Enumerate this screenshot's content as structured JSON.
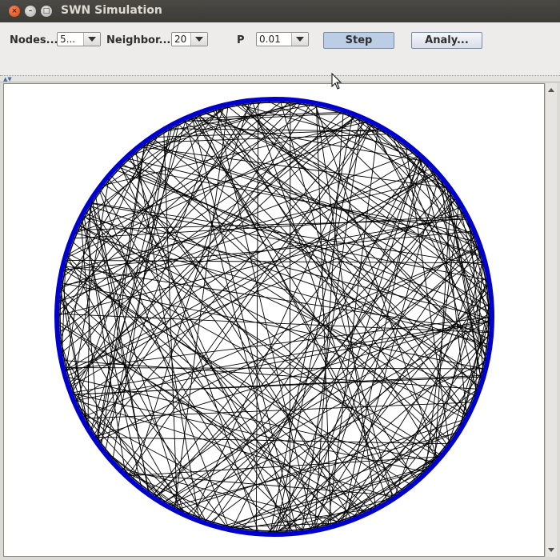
{
  "window": {
    "title": "SWN Simulation"
  },
  "window_controls": {
    "close": "×",
    "minimize": "–",
    "maximize": "□"
  },
  "toolbar": {
    "nodes_label": "Nodes...",
    "nodes_value": "5...",
    "neighbors_label": "Neighbor...",
    "neighbors_value": "20",
    "p_label": "P",
    "p_value": "0.01",
    "step_label": "Step",
    "analyze_label": "Analy..."
  },
  "graph": {
    "ring_color": "#0000cc",
    "edge_color": "#000000"
  }
}
